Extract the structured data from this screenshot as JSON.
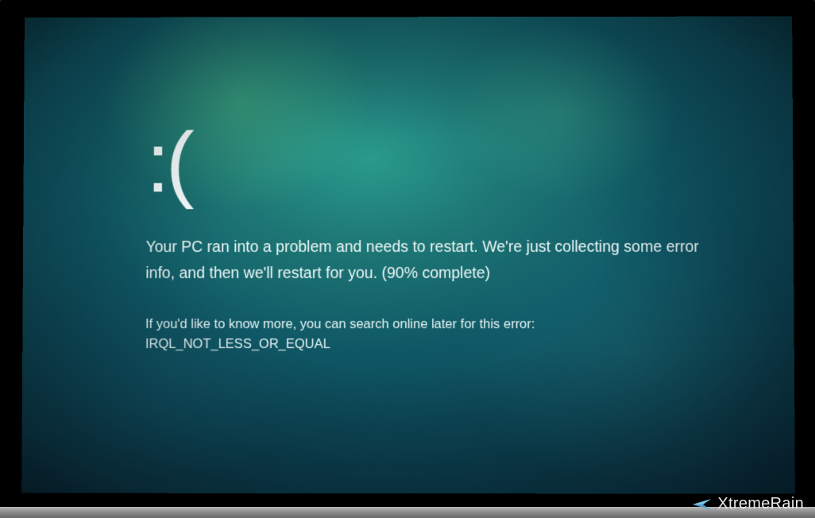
{
  "bsod": {
    "sad_face": ":(",
    "message_line1": "Your PC ran into a problem and needs to restart. We're just collecting some error",
    "message_line2": "info, and then we'll restart for you. (90% complete)",
    "hint_line": "If you'd like to know more, you can search online later for this error:",
    "error_code": "IRQL_NOT_LESS_OR_EQUAL",
    "progress_percent": 90
  },
  "watermark": {
    "text": "XtremeRain",
    "icon": "paper-plane-icon"
  },
  "colors": {
    "bsod_primary": "#0f5a68",
    "bsod_highlight": "#2a9d8f",
    "text": "#ffffff"
  }
}
